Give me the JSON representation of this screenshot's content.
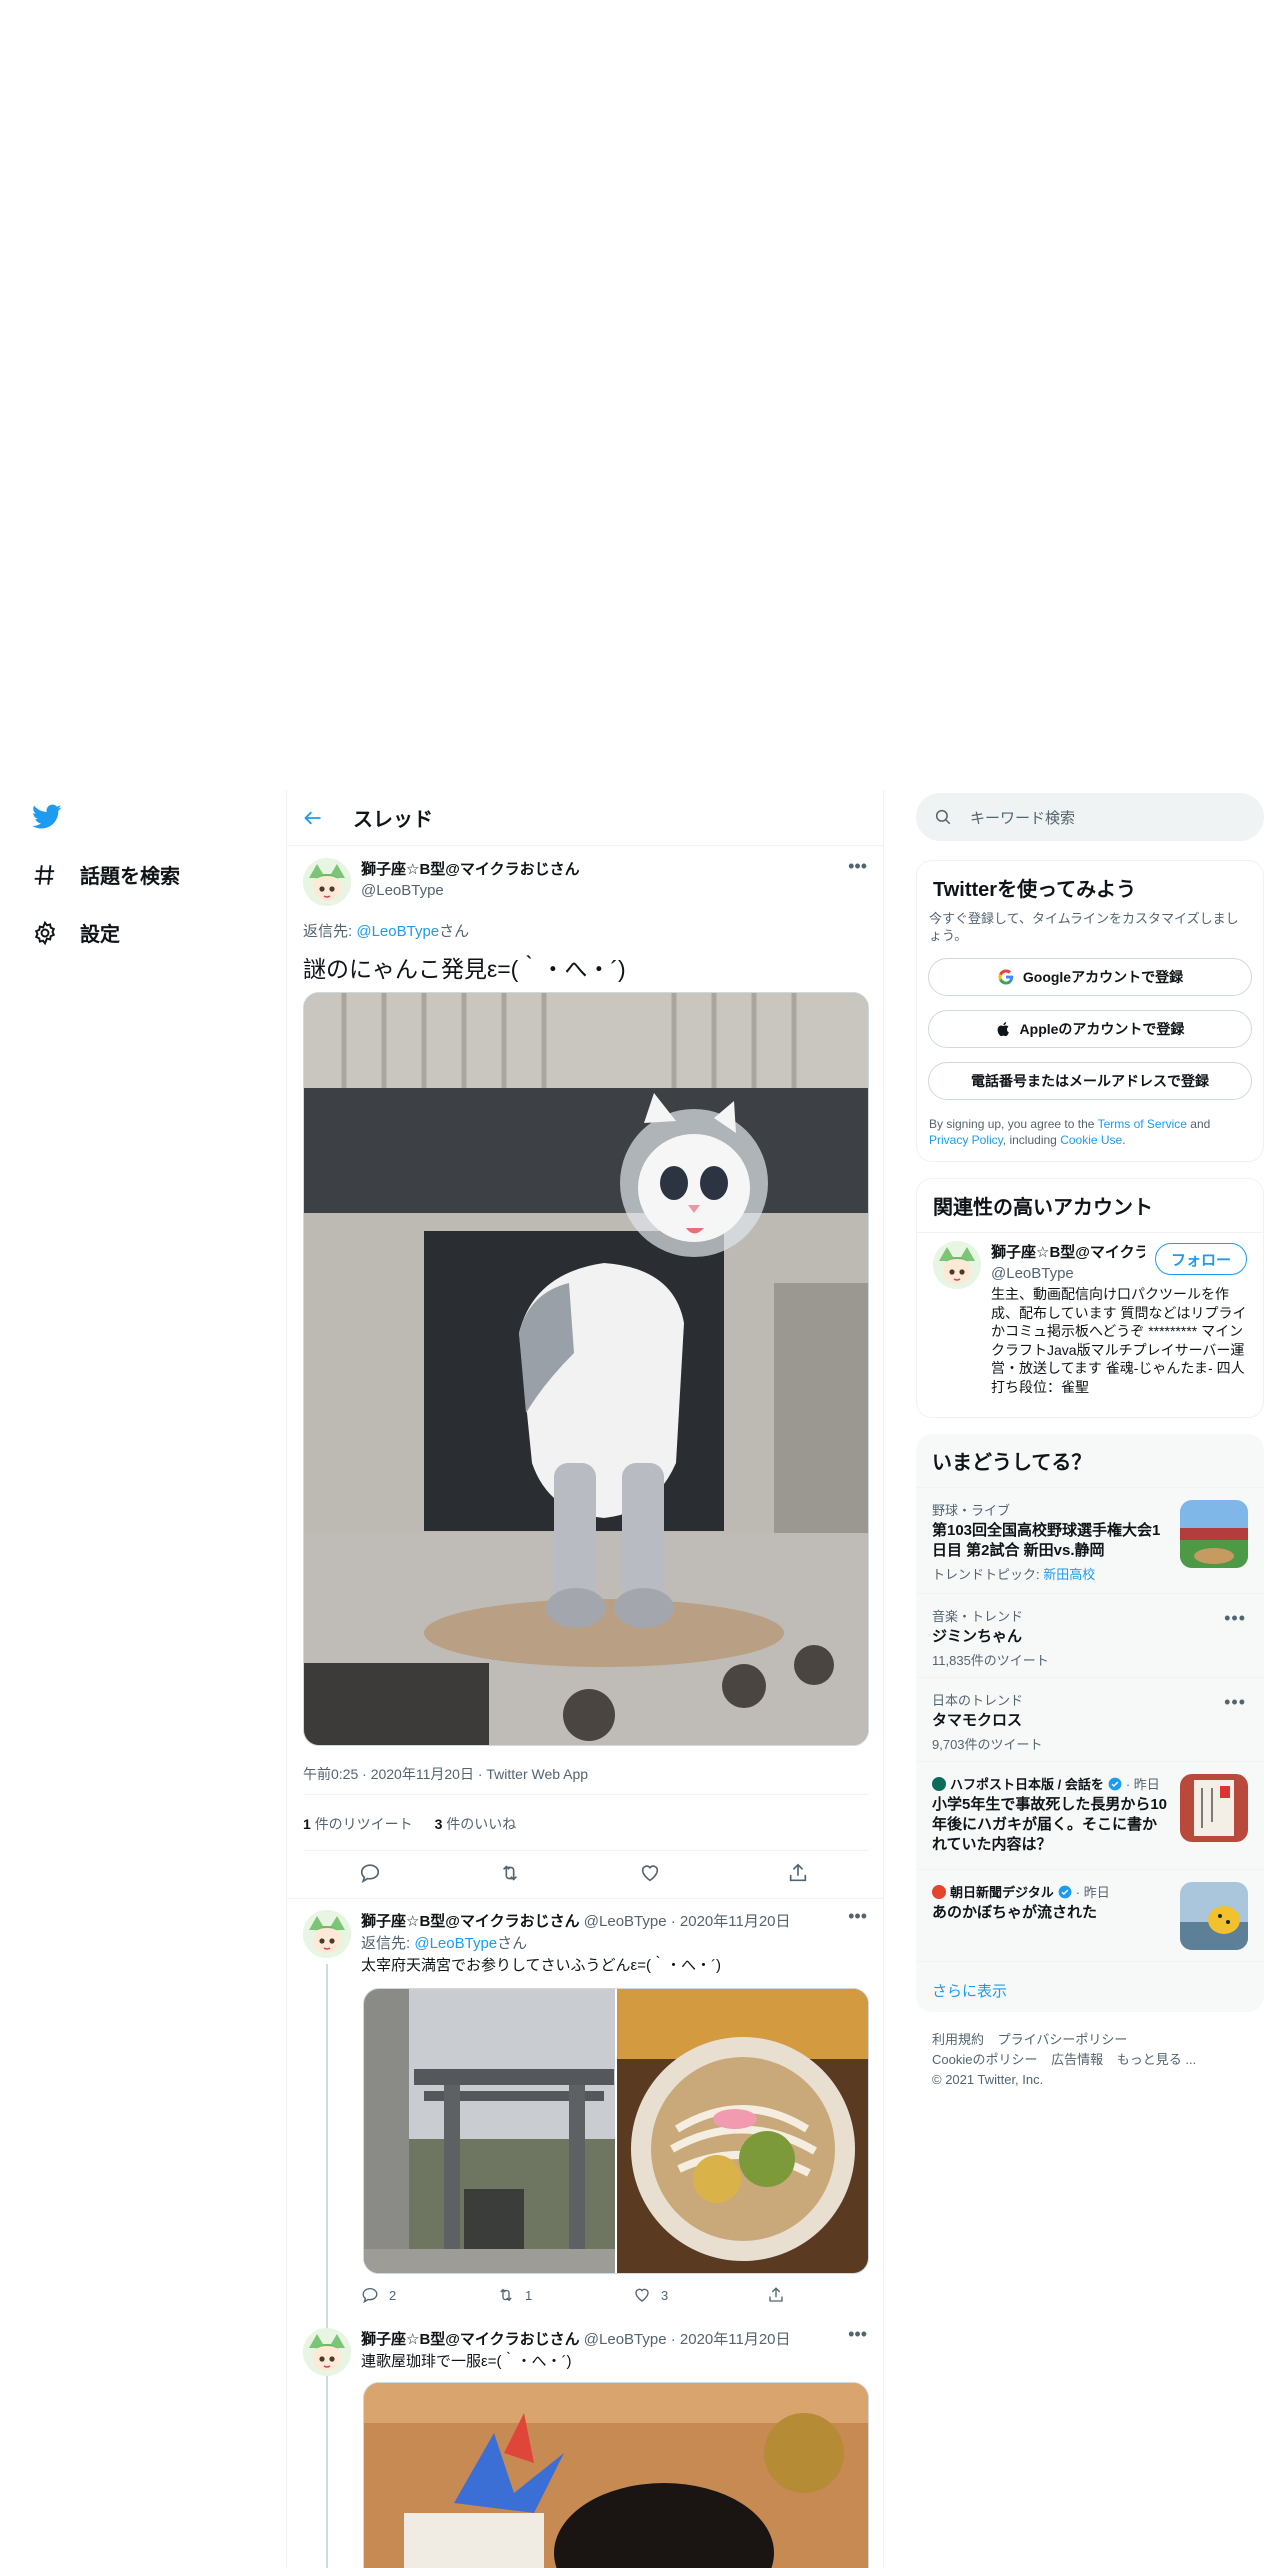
{
  "nav": {
    "explore_label": "話題を検索",
    "settings_label": "設定"
  },
  "thread": {
    "header_title": "スレッド",
    "main_tweet": {
      "display_name": "獅子座☆B型@マイクラおじさん",
      "handle": "@LeoBType",
      "reply_prefix": "返信先:",
      "reply_to": "@LeoBType",
      "reply_suffix": "さん",
      "text": "謎のにゃんこ発見ε=(｀・へ・´)",
      "timestamp": "午前0:25 · 2020年11月20日 · Twitter Web App",
      "retweet_count": "1",
      "retweet_label": "件のリツイート",
      "like_count": "3",
      "like_label": "件のいいね"
    },
    "replies": [
      {
        "display_name": "獅子座☆B型@マイクラおじさん",
        "handle": "@LeoBType",
        "date": "· 2020年11月20日",
        "reply_prefix": "返信先:",
        "reply_to": "@LeoBType",
        "reply_suffix": "さん",
        "text": "太宰府天満宮でお参りしてさいふうどんε=(｀・へ・´)",
        "reply_count": "2",
        "retweet_count": "1",
        "like_count": "3"
      },
      {
        "display_name": "獅子座☆B型@マイクラおじさん",
        "handle": "@LeoBType",
        "date": "· 2020年11月20日",
        "text": "連歌屋珈琲で一服ε=(｀・へ・´)"
      }
    ]
  },
  "search": {
    "placeholder": "キーワード検索"
  },
  "signup_card": {
    "title": "Twitterを使ってみよう",
    "description": "今すぐ登録して、タイムラインをカスタマイズしましょう。",
    "google_button": "Googleアカウントで登録",
    "apple_button": "Appleのアカウントで登録",
    "phone_button": "電話番号またはメールアドレスで登録",
    "legal_1": "By signing up, you agree to the",
    "terms_link": "Terms of Service",
    "legal_2": "and",
    "privacy_link": "Privacy Policy",
    "legal_3": ", including",
    "cookie_link": "Cookie Use",
    "legal_4": "."
  },
  "related_card": {
    "title": "関連性の高いアカウント",
    "display_name": "獅子座☆B型@マイクラおじさん",
    "handle": "@LeoBType",
    "follow_label": "フォロー",
    "bio": "生主、動画配信向け口パクツールを作成、配布しています 質問などはリプライかコミュ掲示板へどうぞ ********* マインクラフトJava版マルチプレイサーバー運営・放送してます 雀魂-じゃんたま- 四人打ち段位：雀聖"
  },
  "trends": {
    "title": "いまどうしてる？",
    "items": [
      {
        "meta": "野球・ライブ",
        "name": "第103回全国高校野球選手権大会1日目 第2試合 新田vs.静岡",
        "sub_prefix": "トレンドトピック:",
        "sub_link": "新田高校",
        "thumb": "baseball-stadium"
      },
      {
        "meta": "音楽・トレンド",
        "name": "ジミンちゃん",
        "sub": "11,835件のツイート"
      },
      {
        "meta": "日本のトレンド",
        "name": "タマモクロス",
        "sub": "9,703件のツイート"
      },
      {
        "source": "ハフポスト日本版 / 会話を",
        "time": "· 昨日",
        "name": "小学5年生で事故死した長男から10年後にハガキが届く。そこに書かれていた内容は？",
        "thumb": "postcard"
      },
      {
        "source": "朝日新聞デジタル",
        "time": "· 昨日",
        "name": "あのかぼちゃが流された",
        "thumb": "pumpkin"
      }
    ],
    "show_more": "さらに表示"
  },
  "footer": {
    "links_row1": [
      "利用規約",
      "プライバシーポリシー"
    ],
    "links_row2": [
      "Cookieのポリシー",
      "広告情報",
      "もっと見る ..."
    ],
    "copyright": "© 2021 Twitter, Inc."
  },
  "colors": {
    "accent": "#1d9bf0",
    "text": "#0f1419",
    "secondary": "#536471",
    "border": "#eff3f4"
  }
}
